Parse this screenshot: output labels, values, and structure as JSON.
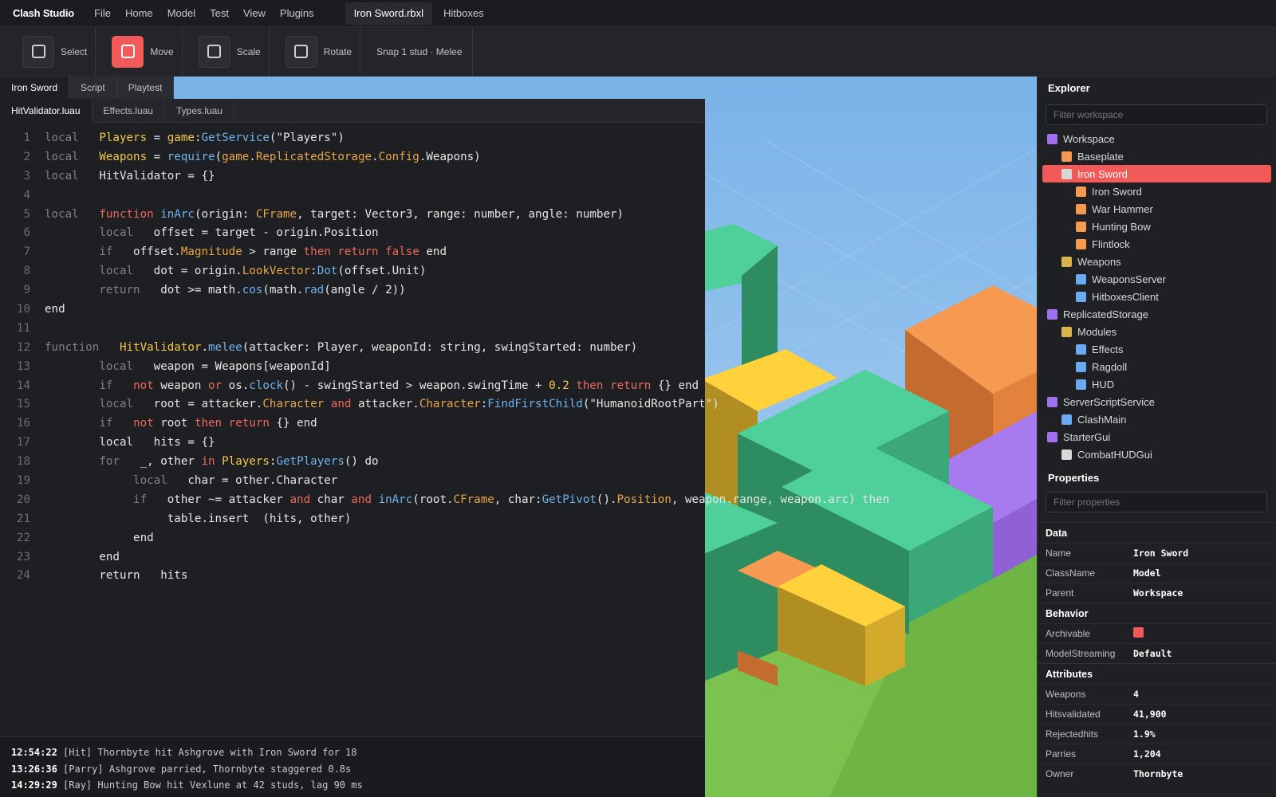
{
  "app": {
    "brand": "Clash Studio"
  },
  "menu": [
    "File",
    "Home",
    "Model",
    "Test",
    "View",
    "Plugins"
  ],
  "doc_tabs": [
    "Iron Sword.rbxl",
    "Hitboxes"
  ],
  "toolbar": {
    "tools": [
      {
        "label": "Select",
        "active": false
      },
      {
        "label": "Move",
        "active": true
      },
      {
        "label": "Scale",
        "active": false
      },
      {
        "label": "Rotate",
        "active": false
      }
    ],
    "snap": "Snap 1 stud · Melee"
  },
  "panel_tabs": [
    "Iron Sword",
    "Script",
    "Playtest"
  ],
  "file_tabs": [
    "HitValidator.luau",
    "Effects.luau",
    "Types.luau"
  ],
  "code_lines": [
    "1",
    "2",
    "3",
    "4",
    "5",
    "6",
    "7",
    "8",
    "9",
    "10",
    "11",
    "12",
    "13",
    "14",
    "15",
    "16",
    "17",
    "18",
    "19",
    "20",
    "21",
    "22",
    "23",
    "24"
  ],
  "console": [
    {
      "time": "12:54:22",
      "msg": " [Hit] Thornbyte hit Ashgrove with Iron Sword for 18"
    },
    {
      "time": "13:26:36",
      "msg": " [Parry] Ashgrove parried, Thornbyte staggered 0.8s"
    },
    {
      "time": "14:29:29",
      "msg": " [Ray] Hunting Bow hit Vexlune at 42 studs, lag 90 ms"
    }
  ],
  "explorer": {
    "title": "Explorer",
    "filter_placeholder": "Filter workspace",
    "nodes": [
      {
        "label": "Workspace",
        "depth": 0,
        "color": "#a070f0",
        "selected": false
      },
      {
        "label": "Baseplate",
        "depth": 1,
        "color": "#f59a50",
        "selected": false
      },
      {
        "label": "Iron Sword",
        "depth": 1,
        "color": "#d8d8d8",
        "selected": true
      },
      {
        "label": "Iron Sword",
        "depth": 2,
        "color": "#f59a50",
        "selected": false
      },
      {
        "label": "War Hammer",
        "depth": 2,
        "color": "#f59a50",
        "selected": false
      },
      {
        "label": "Hunting Bow",
        "depth": 2,
        "color": "#f59a50",
        "selected": false
      },
      {
        "label": "Flintlock",
        "depth": 2,
        "color": "#f59a50",
        "selected": false
      },
      {
        "label": "Weapons",
        "depth": 1,
        "color": "#d9b44a",
        "selected": false
      },
      {
        "label": "WeaponsServer",
        "depth": 2,
        "color": "#6aaaf0",
        "selected": false
      },
      {
        "label": "HitboxesClient",
        "depth": 2,
        "color": "#6aaaf0",
        "selected": false
      },
      {
        "label": "ReplicatedStorage",
        "depth": 0,
        "color": "#a070f0",
        "selected": false
      },
      {
        "label": "Modules",
        "depth": 1,
        "color": "#d9b44a",
        "selected": false
      },
      {
        "label": "Effects",
        "depth": 2,
        "color": "#6aaaf0",
        "selected": false
      },
      {
        "label": "Ragdoll",
        "depth": 2,
        "color": "#6aaaf0",
        "selected": false
      },
      {
        "label": "HUD",
        "depth": 2,
        "color": "#6aaaf0",
        "selected": false
      },
      {
        "label": "ServerScriptService",
        "depth": 0,
        "color": "#a070f0",
        "selected": false
      },
      {
        "label": "ClashMain",
        "depth": 1,
        "color": "#6aaaf0",
        "selected": false
      },
      {
        "label": "StarterGui",
        "depth": 0,
        "color": "#a070f0",
        "selected": false
      },
      {
        "label": "CombatHUDGui",
        "depth": 1,
        "color": "#d8d8d8",
        "selected": false
      }
    ]
  },
  "properties": {
    "title": "Properties",
    "filter_placeholder": "Filter properties",
    "groups": [
      {
        "name": "Data",
        "rows": [
          {
            "key": "Name",
            "value": "Iron Sword"
          },
          {
            "key": "ClassName",
            "value": "Model"
          },
          {
            "key": "Parent",
            "value": "Workspace"
          }
        ]
      },
      {
        "name": "Behavior",
        "rows": [
          {
            "key": "Archivable",
            "value": "",
            "swatch": "#f25a5a"
          },
          {
            "key": "ModelStreaming",
            "value": "Default"
          }
        ]
      },
      {
        "name": "Attributes",
        "rows": [
          {
            "key": "Weapons",
            "value": "4"
          },
          {
            "key": "Hitsvalidated",
            "value": "41,900"
          },
          {
            "key": "Rejectedhits",
            "value": "1.9%"
          },
          {
            "key": "Parries",
            "value": "1,204"
          },
          {
            "key": "Owner",
            "value": "Thornbyte"
          }
        ]
      }
    ]
  }
}
